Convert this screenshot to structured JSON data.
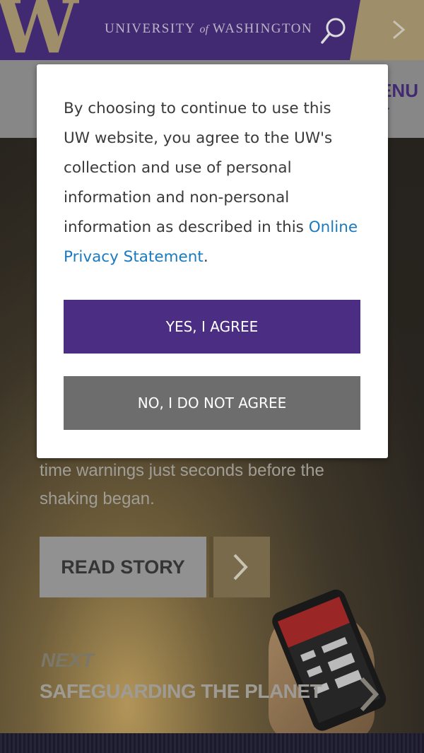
{
  "colors": {
    "uw_purple": "#4b2e83",
    "uw_gold": "#b7a57a",
    "link_blue": "#1a7ac0",
    "decline_gray": "#6d6d6d"
  },
  "header": {
    "logo_letter": "W",
    "wordmark_left": "UNIVERSITY",
    "wordmark_of": "of",
    "wordmark_right": "WASHINGTON",
    "search_icon": "search-icon",
    "next_icon": "chevron-right-icon"
  },
  "subnav": {
    "menu_label": "ENU"
  },
  "hero": {
    "body_line_1": "time warnings just seconds before the",
    "body_line_2": "shaking began.",
    "read_story_label": "READ STORY",
    "next_label": "NEXT",
    "next_title": "SAFEGUARDING THE PLANET"
  },
  "consent_modal": {
    "message": "By choosing to continue to use this UW website, you agree to the UW's collection and use of personal information and non-personal information as described in this",
    "link_text": "Online Privacy Statement",
    "link_suffix": ".",
    "agree_label": "YES, I AGREE",
    "decline_label": "NO, I DO NOT AGREE"
  }
}
